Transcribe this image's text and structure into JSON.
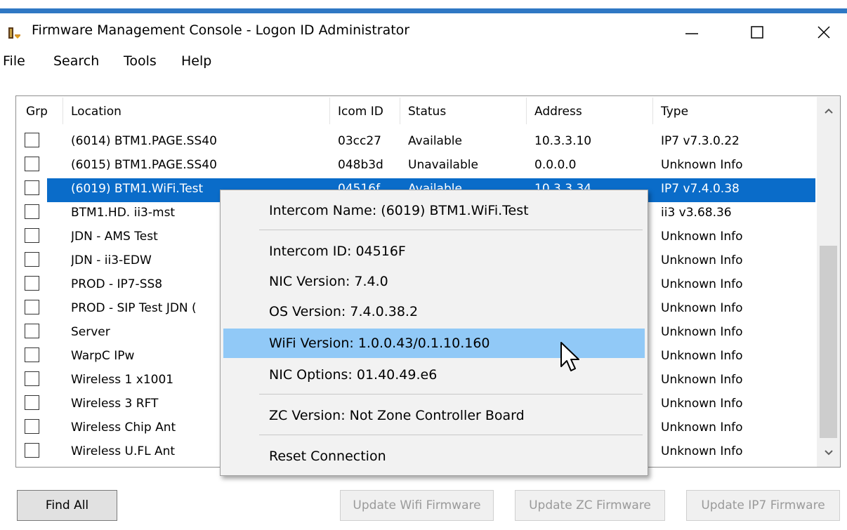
{
  "window": {
    "title": "Firmware Management Console - Logon ID Administrator",
    "accent_color": "#2f78c4",
    "controls": {
      "minimize_icon": "—",
      "maximize_icon": "☐",
      "close_icon": "✕"
    }
  },
  "menu": [
    "File",
    "Search",
    "Tools",
    "Help"
  ],
  "table": {
    "columns": [
      "Grp",
      "Location",
      "Icom ID",
      "Status",
      "Address",
      "Type"
    ],
    "rows": [
      {
        "location": "(6014) BTM1.PAGE.SS40",
        "icom_id": "03cc27",
        "status": "Available",
        "address": "10.3.3.10",
        "type": "IP7 v7.3.0.22",
        "checked": false
      },
      {
        "location": "(6015) BTM1.PAGE.SS40",
        "icom_id": "048b3d",
        "status": "Unavailable",
        "address": "0.0.0.0",
        "type": "Unknown Info",
        "checked": false
      },
      {
        "location": "(6019) BTM1.WiFi.Test",
        "icom_id": "04516f",
        "status": "Available",
        "address": "10.3.3.34",
        "type": "IP7 v7.4.0.38",
        "checked": false,
        "selected": true
      },
      {
        "location": "BTM1.HD. ii3-mst",
        "icom_id": "",
        "status": "",
        "address": "",
        "type": "ii3 v3.68.36",
        "checked": false
      },
      {
        "location": "JDN - AMS Test",
        "icom_id": "",
        "status": "",
        "address": "",
        "type": "Unknown Info",
        "checked": false
      },
      {
        "location": "JDN - ii3-EDW",
        "icom_id": "",
        "status": "",
        "address": "",
        "type": "Unknown Info",
        "checked": false
      },
      {
        "location": "PROD - IP7-SS8",
        "icom_id": "",
        "status": "",
        "address": "",
        "type": "Unknown Info",
        "checked": false
      },
      {
        "location": "PROD - SIP Test JDN (",
        "icom_id": "",
        "status": "",
        "address": "",
        "type": "Unknown Info",
        "checked": false
      },
      {
        "location": "Server",
        "icom_id": "",
        "status": "",
        "address": "",
        "type": "Unknown Info",
        "checked": false
      },
      {
        "location": "WarpC IPw",
        "icom_id": "",
        "status": "",
        "address": "",
        "type": "Unknown Info",
        "checked": false
      },
      {
        "location": "Wireless 1 x1001",
        "icom_id": "",
        "status": "",
        "address": "",
        "type": "Unknown Info",
        "checked": false
      },
      {
        "location": "Wireless 3 RFT",
        "icom_id": "",
        "status": "",
        "address": "",
        "type": "Unknown Info",
        "checked": false
      },
      {
        "location": "Wireless Chip Ant",
        "icom_id": "",
        "status": "",
        "address": "",
        "type": "Unknown Info",
        "checked": false
      },
      {
        "location": "Wireless U.FL Ant",
        "icom_id": "",
        "status": "",
        "address": "",
        "type": "Unknown Info",
        "checked": false
      }
    ],
    "selection_color": "#0a6cc9"
  },
  "context_menu": {
    "items": [
      "Intercom Name: (6019) BTM1.WiFi.Test",
      "Intercom ID: 04516F",
      "NIC Version: 7.4.0",
      "OS Version: 7.4.0.38.2",
      "WiFi Version: 1.0.0.43/0.1.10.160",
      "NIC Options: 01.40.49.e6",
      "ZC Version: Not Zone Controller Board",
      "Reset Connection"
    ],
    "hovered_item": "WiFi Version: 1.0.0.43/0.1.10.160",
    "hover_color": "#91c9f7"
  },
  "buttons": {
    "find_all": "Find All",
    "update_wifi": "Update Wifi Firmware",
    "update_zc": "Update ZC Firmware",
    "update_ip7": "Update IP7 Firmware"
  }
}
